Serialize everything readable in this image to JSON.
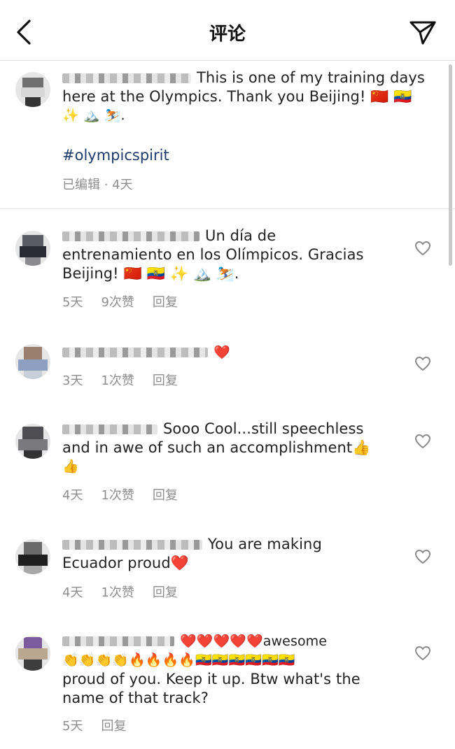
{
  "header": {
    "title": "评论"
  },
  "caption": {
    "line1": "This is one of my training days",
    "line2": "here at the Olympics. Thank you Beijing! 🇨🇳 🇪🇨",
    "line3": "✨ 🏔️ ⛷️.",
    "hashtag": "#olympicspirit",
    "meta": "已编辑 · 4天"
  },
  "comments": [
    {
      "lines": [
        "Un día de",
        "entrenamiento en los Olímpicos. Gracias",
        "Beijing! 🇨🇳 🇪🇨 ✨ 🏔️ ⛷️."
      ],
      "time": "5天",
      "likes": "9次赞",
      "reply": "回复"
    },
    {
      "lines": [
        "❤️"
      ],
      "time": "3天",
      "likes": "1次赞",
      "reply": "回复"
    },
    {
      "lines": [
        "Sooo Cool...still speechless",
        "and in awe of such an accomplishment👍",
        "👍"
      ],
      "time": "4天",
      "likes": "1次赞",
      "reply": "回复"
    },
    {
      "lines": [
        "You are making",
        "Ecuador proud❤️"
      ],
      "time": "4天",
      "likes": "1次赞",
      "reply": "回复"
    },
    {
      "lines": [
        "❤️❤️❤️❤️❤️awesome",
        "👏👏👏👏🔥🔥🔥🔥🇪🇨🇪🇨🇪🇨🇪🇨🇪🇨🇪🇨",
        "proud of you. Keep it up. Btw what's the",
        "name of that track?"
      ],
      "time": "5天",
      "reply": "回复"
    }
  ],
  "colors": {
    "text": "#262626",
    "meta": "#8e8e8e",
    "hashtag": "#1e3c6e",
    "divider": "#e6e6e6"
  },
  "icons": {
    "back": "chevron-left-icon",
    "send": "paper-plane-icon",
    "like": "heart-outline-icon"
  }
}
